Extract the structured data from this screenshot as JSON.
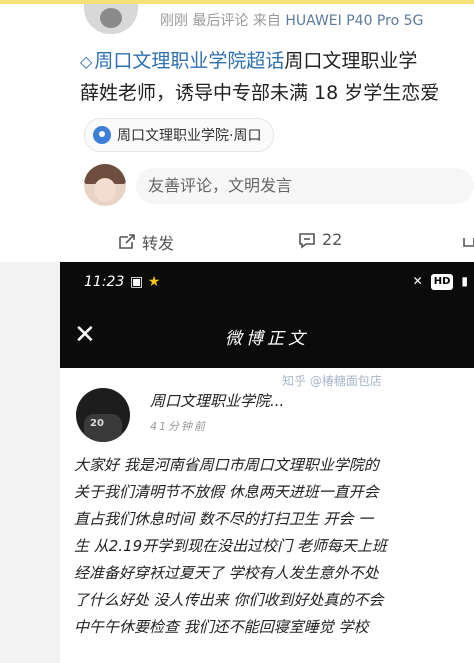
{
  "post": {
    "meta": {
      "time": "刚刚",
      "last_comment": "最后评论",
      "from_label": "来自",
      "device": "HUAWEI P40 Pro 5G"
    },
    "topic": "周口文理职业学院超话",
    "title_tail": "周口文理职业学",
    "title_line2": "薛姓老师，诱导中专部未满 18 岁学生恋爱",
    "location": "周口文理职业学院·周口",
    "comment_placeholder": "友善评论，文明发言",
    "actions": {
      "repost_label": "转发",
      "comment_count": "22"
    }
  },
  "screenshot": {
    "status_time": "11:23",
    "title": "微博正文",
    "author_name": "周口文理职业学院...",
    "author_time": "41分钟前",
    "body_lines": [
      "大家好 我是河南省周口市周口文理职业学院的",
      "关于我们清明节不放假 休息两天进班一直开会",
      "直占我们休息时间 数不尽的打扫卫生 开会 一",
      "生 从2.19开学到现在没出过校门 老师每天上班",
      "经准备好穿袄过夏天了 学校有人发生意外不处",
      "了什么好处 没人传出来 你们收到好处真的不会",
      "中午午休要检查 我们还不能回寝室睡觉 学校"
    ]
  },
  "watermark": "知乎 @椿糖面包店",
  "colors": {
    "topic_blue": "#2e6fb0",
    "status_bar": "#0b0b0b",
    "background": "#f3f3f3"
  }
}
